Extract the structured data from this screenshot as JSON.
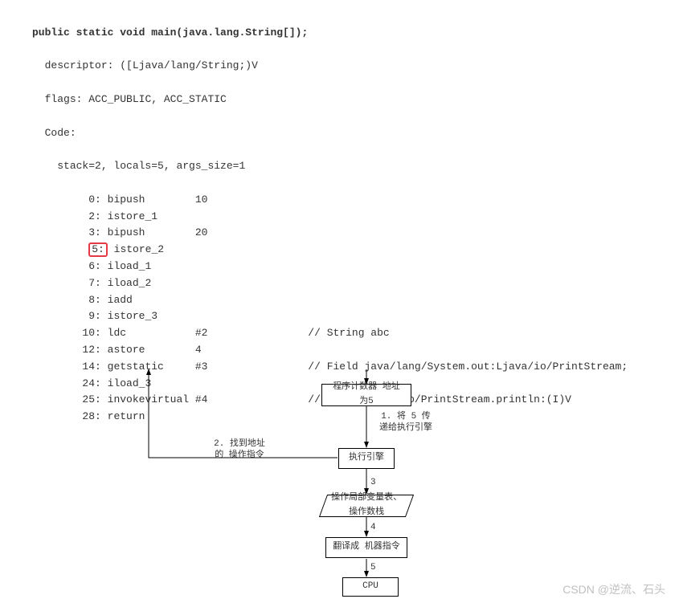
{
  "code": {
    "signature": "public static void main(java.lang.String[]);",
    "descriptor_label": "descriptor:",
    "descriptor_value": "([Ljava/lang/String;)V",
    "flags_label": "flags:",
    "flags_value": "ACC_PUBLIC, ACC_STATIC",
    "code_label": "Code:",
    "stack_line": "stack=2, locals=5, args_size=1",
    "instructions": [
      {
        "pc": "0:",
        "op": "bipush",
        "arg": "10",
        "comment": ""
      },
      {
        "pc": "2:",
        "op": "istore_1",
        "arg": "",
        "comment": ""
      },
      {
        "pc": "3:",
        "op": "bipush",
        "arg": "20",
        "comment": ""
      },
      {
        "pc": "5:",
        "op": "istore_2",
        "arg": "",
        "comment": "",
        "highlight": true
      },
      {
        "pc": "6:",
        "op": "iload_1",
        "arg": "",
        "comment": ""
      },
      {
        "pc": "7:",
        "op": "iload_2",
        "arg": "",
        "comment": ""
      },
      {
        "pc": "8:",
        "op": "iadd",
        "arg": "",
        "comment": ""
      },
      {
        "pc": "9:",
        "op": "istore_3",
        "arg": "",
        "comment": ""
      },
      {
        "pc": "10:",
        "op": "ldc",
        "arg": "#2",
        "comment": "// String abc"
      },
      {
        "pc": "12:",
        "op": "astore",
        "arg": "4",
        "comment": ""
      },
      {
        "pc": "14:",
        "op": "getstatic",
        "arg": "#3",
        "comment": "// Field java/lang/System.out:Ljava/io/PrintStream;"
      },
      {
        "pc": "24:",
        "op": "iload_3",
        "arg": "",
        "comment": ""
      },
      {
        "pc": "25:",
        "op": "invokevirtual",
        "arg": "#4",
        "comment": "// Method java/io/PrintStream.println:(I)V"
      },
      {
        "pc": "28:",
        "op": "return",
        "arg": "",
        "comment": ""
      }
    ]
  },
  "diagram": {
    "pc_node": "程序计数器 地址为5",
    "engine_node": "执行引擎",
    "table_node": "操作局部变量表、\n操作数栈",
    "translate_node": "翻译成 机器指令",
    "cpu_node": "CPU",
    "label1": "1. 将 5 传递给执行引擎",
    "label2": "2. 找到地址的 操作指令",
    "label3": "3",
    "label4": "4",
    "label5": "5"
  },
  "watermark": "CSDN @逆流、石头"
}
